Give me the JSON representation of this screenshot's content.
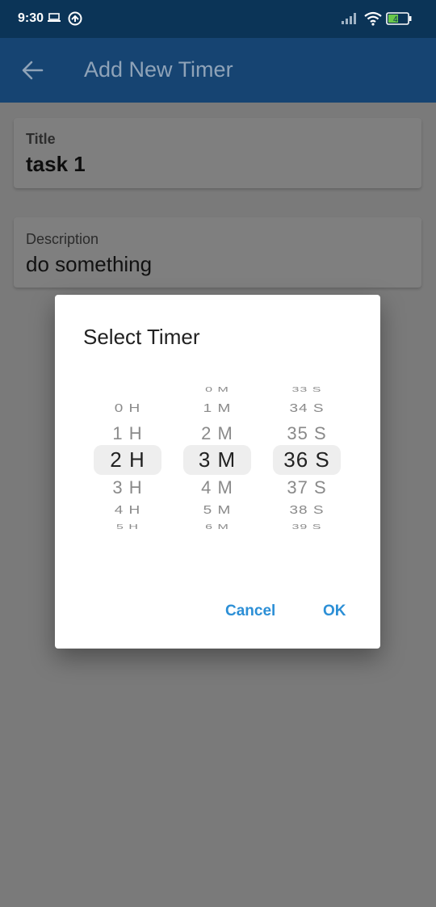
{
  "status_bar": {
    "time": "9:30",
    "battery": "47"
  },
  "app_bar": {
    "title": "Add New Timer"
  },
  "form": {
    "title_label": "Title",
    "title_value": "task 1",
    "description_label": "Description",
    "description_value": "do something"
  },
  "dialog": {
    "title": "Select Timer",
    "hours": {
      "above": [
        "0 H",
        "1 H"
      ],
      "selected": "2 H",
      "below": [
        "3 H",
        "4 H",
        "5 H"
      ]
    },
    "minutes": {
      "above": [
        "0 M",
        "1 M",
        "2 M"
      ],
      "selected": "3 M",
      "below": [
        "4 M",
        "5 M",
        "6 M"
      ]
    },
    "seconds": {
      "above": [
        "33 S",
        "34 S",
        "35 S"
      ],
      "selected": "36 S",
      "below": [
        "37 S",
        "38 S",
        "39 S"
      ]
    },
    "cancel_label": "Cancel",
    "ok_label": "OK"
  },
  "colors": {
    "status_bar": "#0b3457",
    "app_bar": "#164472",
    "accent": "#2c8fd6"
  }
}
